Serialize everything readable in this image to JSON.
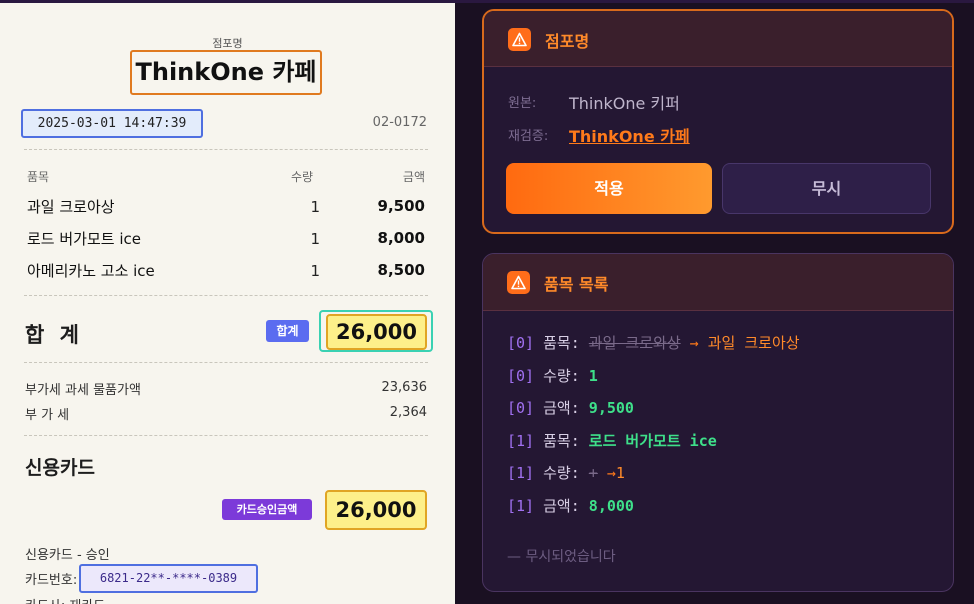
{
  "receipt": {
    "store_label": "점포명",
    "store_name": "ThinkOne 카페",
    "datetime": "2025-03-01 14:47:39",
    "code": "02-0172",
    "columns": {
      "item": "품목",
      "qty": "수량",
      "amount": "금액"
    },
    "items": [
      {
        "name": "과일 크로아상",
        "qty": "1",
        "amount": "9,500"
      },
      {
        "name": "로드 버가모트 ice",
        "qty": "1",
        "amount": "8,000"
      },
      {
        "name": "아메리카노 고소 ice",
        "qty": "1",
        "amount": "8,500"
      }
    ],
    "total_label": "합 계",
    "total_badge": "합계",
    "total_amount": "26,000",
    "vat_base_label": "부가세 과세 물품가액",
    "vat_base_value": "23,636",
    "vat_label": "부 가 세",
    "vat_value": "2,364",
    "card_section": "신용카드",
    "card_badge": "카드승인금액",
    "card_amount": "26,000",
    "card_status": "신용카드 - 승인",
    "card_no_label": "카드번호:",
    "card_no": "6821-22**-****-0389",
    "card_issuer_partial": "카드사: 재카드"
  },
  "store_panel": {
    "title": "점포명",
    "original_label": "원본:",
    "original_value": "ThinkOne 키퍼",
    "recheck_label": "재검증:",
    "recheck_value": "ThinkOne 카페",
    "apply_button": "적용",
    "ignore_button": "무시"
  },
  "items_panel": {
    "title": "품목 목록",
    "lines": [
      {
        "idx": "[0]",
        "key": "품목:",
        "old": "과일 크로와상",
        "arrow": "→",
        "value": "과일 크로아상"
      },
      {
        "idx": "[0]",
        "key": "수량:",
        "value": "1"
      },
      {
        "idx": "[0]",
        "key": "금액:",
        "value": "9,500"
      },
      {
        "idx": "[1]",
        "key": "품목:",
        "value": "로드 버가모트 ice"
      },
      {
        "idx": "[1]",
        "key": "수량:",
        "old": "+",
        "arrow": "→",
        "value": "1"
      },
      {
        "idx": "[1]",
        "key": "금액:",
        "value": "8,000"
      }
    ],
    "ignored_text": "— 무시되었습니다"
  },
  "colors": {
    "accent": "#ff6d1a",
    "panel_bg": "#241733",
    "receipt_bg": "#f7f5ee",
    "value_green": "#3ee08a",
    "index_purple": "#a070f0"
  }
}
